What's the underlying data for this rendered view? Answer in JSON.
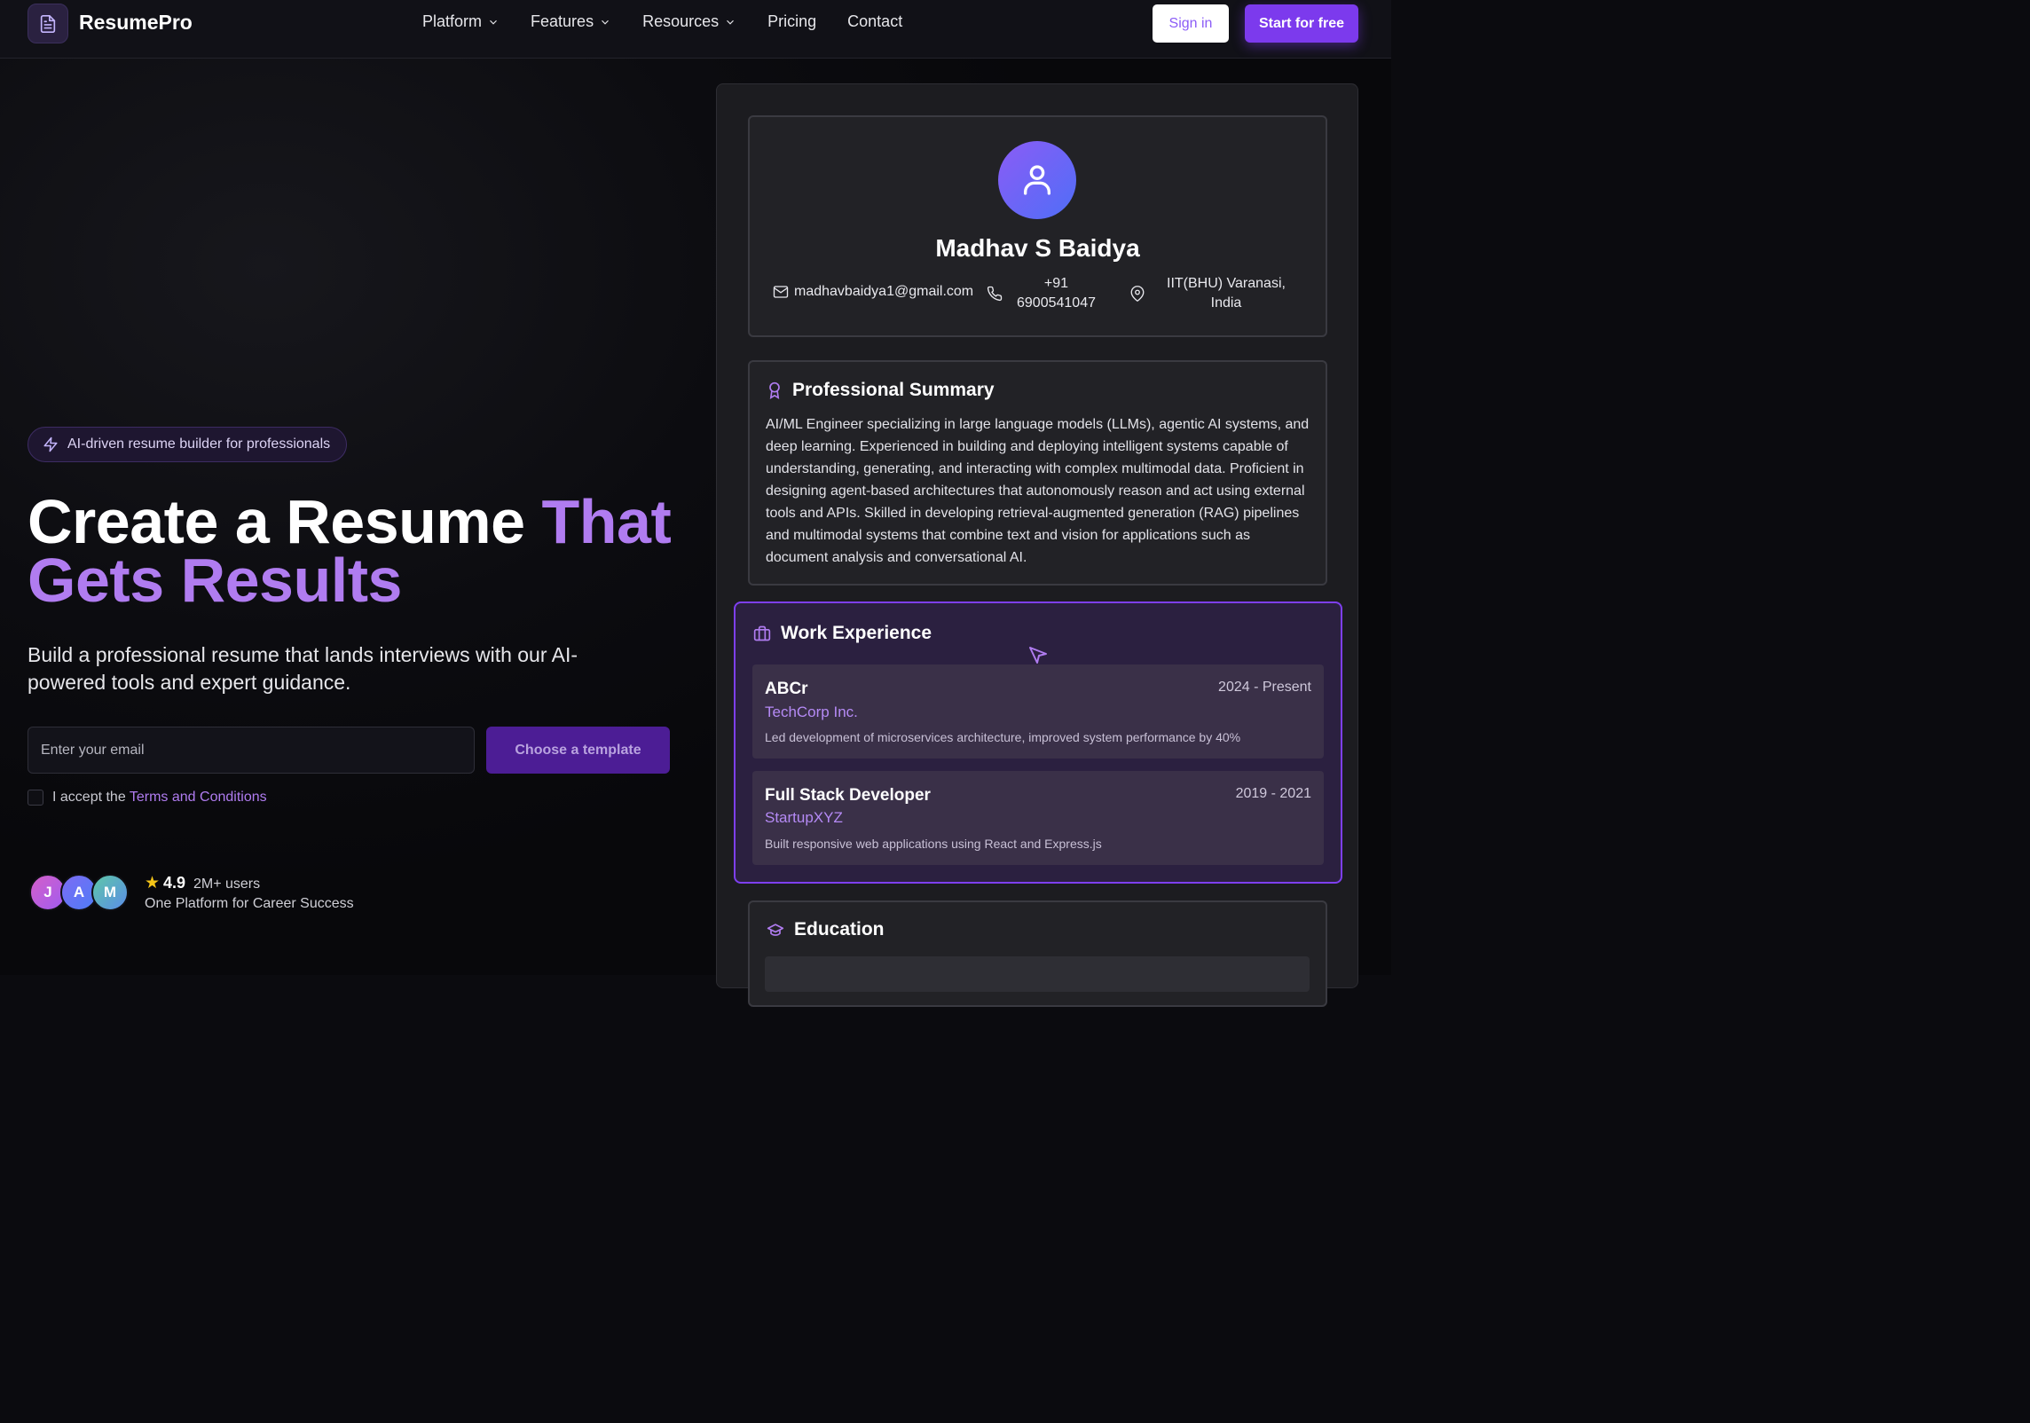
{
  "nav": {
    "brand": "ResumePro",
    "menu": [
      "Platform",
      "Features",
      "Resources",
      "Pricing",
      "Contact"
    ],
    "signin_label": "Sign in",
    "start_label": "Start for free"
  },
  "hero": {
    "badge": "AI-driven resume builder for professionals",
    "title_part1": "Create a Resume ",
    "title_accent1": "That",
    "title_accent2": "Gets Results",
    "subtitle": "Build a professional resume that lands interviews with our AI-powered tools and expert guidance.",
    "email_placeholder": "Enter your email",
    "template_button": "Choose a template",
    "terms_prefix": "I accept the ",
    "terms_link": "Terms and Conditions",
    "avatars": [
      "J",
      "A",
      "M"
    ],
    "rating": "4.9",
    "users": "2M+ users",
    "tagline": "One Platform for Career Success"
  },
  "resume": {
    "name": "Madhav S Baidya",
    "email": "madhavbaidya1@gmail.com",
    "phone_line1": "+91",
    "phone_line2": "6900541047",
    "location_line1": "IIT(BHU) Varanasi,",
    "location_line2": "India",
    "summary_title": "Professional Summary",
    "summary": "AI/ML Engineer specializing in large language models (LLMs), agentic AI systems, and deep learning. Experienced in building and deploying intelligent systems capable of understanding, generating, and interacting with complex multimodal data. Proficient in designing agent-based architectures that autonomously reason and act using external tools and APIs. Skilled in developing retrieval-augmented generation (RAG) pipelines and multimodal systems that combine text and vision for applications such as document analysis and conversational AI.",
    "work_title": "Work Experience",
    "jobs": [
      {
        "title": "ABCr",
        "company": "TechCorp Inc.",
        "dates": "2024 - Present",
        "desc": "Led development of microservices architecture, improved system performance by 40%"
      },
      {
        "title": "Full Stack Developer",
        "company": "StartupXYZ",
        "dates": "2019 - 2021",
        "desc": "Built responsive web applications using React and Express.js"
      }
    ],
    "education_title": "Education"
  },
  "colors": {
    "accent": "#b07cf0",
    "primary": "#7c3aed",
    "work_border": "#7e3ff0"
  },
  "icons": [
    "document-icon",
    "chevron-down-icon",
    "lightning-icon",
    "user-icon",
    "mail-icon",
    "phone-icon",
    "location-pin-icon",
    "award-icon",
    "briefcase-icon",
    "graduation-cap-icon",
    "star-icon",
    "cursor-arrow-icon"
  ]
}
